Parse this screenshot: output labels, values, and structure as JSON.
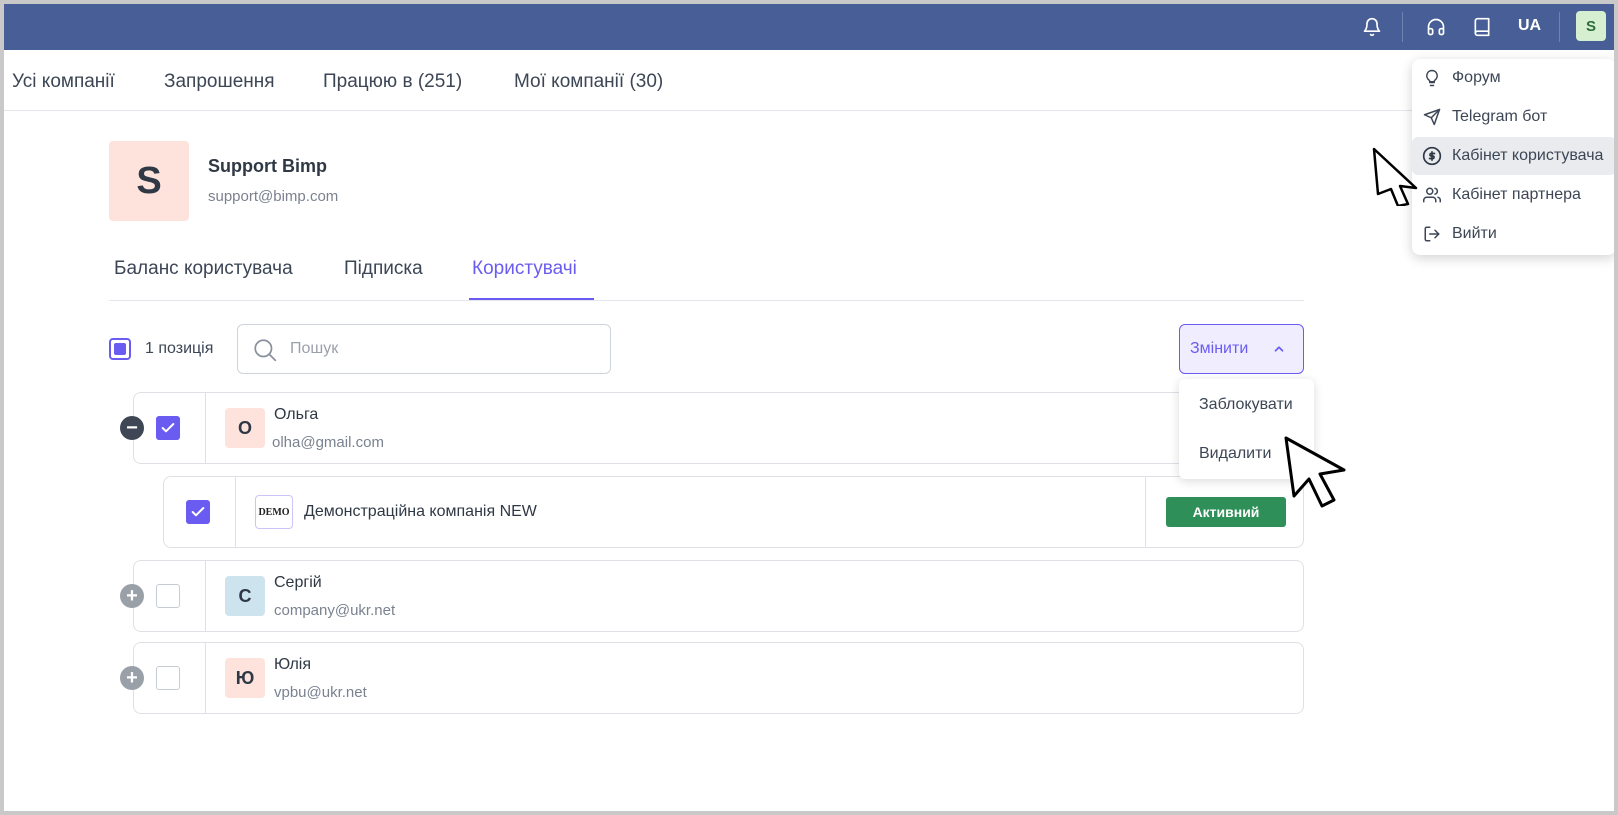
{
  "topbar": {
    "icons": [
      "bell-icon",
      "headset-icon",
      "book-icon"
    ],
    "language": "UA",
    "user_initial": "S",
    "colors": {
      "background": "#475f96"
    }
  },
  "nav": {
    "items": [
      {
        "label": "Усі компанії"
      },
      {
        "label": "Запрошення"
      },
      {
        "label": "Працюю в (251)"
      },
      {
        "label": "Мої компанії (30)"
      }
    ]
  },
  "profile": {
    "initial": "S",
    "name": "Support Bimp",
    "email": "support@bimp.com"
  },
  "subtabs": {
    "items": [
      {
        "label": "Баланс користувача"
      },
      {
        "label": "Підписка"
      },
      {
        "label": "Користувачі",
        "active": true
      }
    ]
  },
  "toolbar": {
    "selected_count_label": "1 позиція",
    "search_placeholder": "Пошук",
    "change_button_label": "Змінити",
    "change_menu": [
      {
        "label": "Заблокувати"
      },
      {
        "label": "Видалити"
      }
    ]
  },
  "users": [
    {
      "initial": "О",
      "name": "Ольга",
      "email": "olha@gmail.com",
      "expanded": true,
      "checked": true,
      "avatar_color": "#fde3dc",
      "companies": [
        {
          "logo_text": "DEMO",
          "name": "Демонстраційна компанія NEW",
          "status": "Активний",
          "checked": true
        }
      ]
    },
    {
      "initial": "С",
      "name": "Сергій",
      "email": "company@ukr.net",
      "expanded": false,
      "checked": false,
      "avatar_color": "#cde4ef"
    },
    {
      "initial": "Ю",
      "name": "Юлія",
      "email": "vpbu@ukr.net",
      "expanded": false,
      "checked": false,
      "avatar_color": "#fde3dc"
    }
  ],
  "user_menu": {
    "items": [
      {
        "label": "Форум",
        "icon": "lightbulb-icon"
      },
      {
        "label": "Telegram бот",
        "icon": "telegram-icon"
      },
      {
        "label": "Кабінет користувача",
        "icon": "dollar-circle-icon",
        "highlighted": true
      },
      {
        "label": "Кабінет партнера",
        "icon": "users-icon"
      },
      {
        "label": "Вийти",
        "icon": "logout-icon"
      }
    ]
  },
  "colors": {
    "accent": "#6a5cf0",
    "status_active": "#2f8f58"
  }
}
